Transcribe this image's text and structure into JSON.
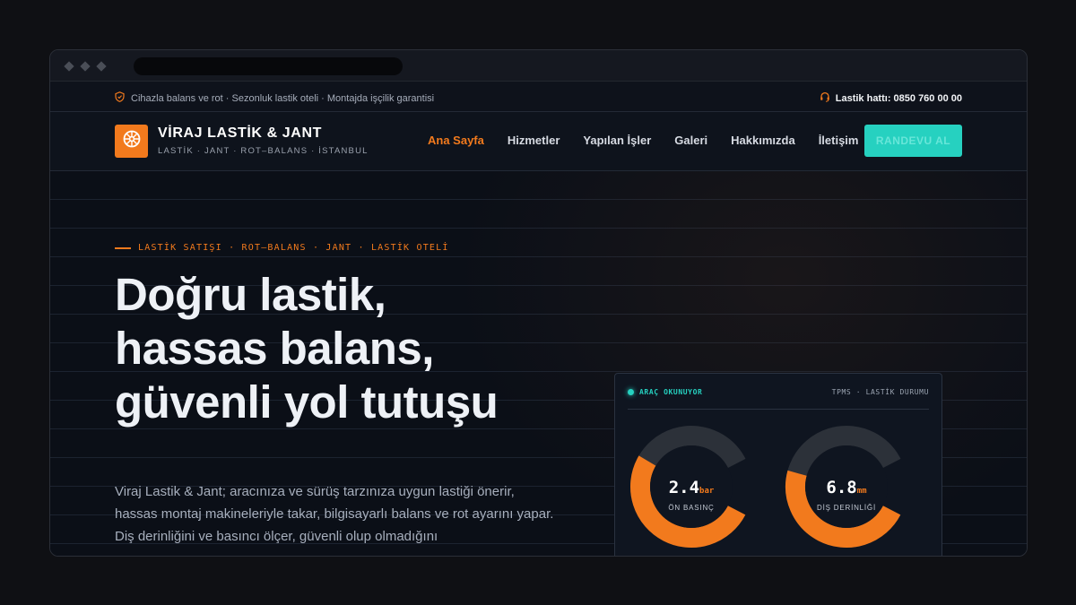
{
  "topbar": {
    "info": "Cihazla balans ve rot · Sezonluk lastik oteli · Montajda işçilik garantisi",
    "hotline": "Lastik hattı: 0850 760 00 00",
    "info_icon": "shield-icon",
    "hotline_icon": "headset-icon"
  },
  "brand": {
    "title": "VİRAJ LASTİK & JANT",
    "subtitle": "LASTİK · JANT · ROT–BALANS · İSTANBUL",
    "logo_icon": "wheel-icon"
  },
  "nav": {
    "items": [
      {
        "label": "Ana Sayfa"
      },
      {
        "label": "Hizmetler"
      },
      {
        "label": "Yapılan İşler"
      },
      {
        "label": "Galeri"
      },
      {
        "label": "Hakkımızda"
      },
      {
        "label": "İletişim"
      }
    ],
    "active_index": 0,
    "cta": "RANDEVU AL"
  },
  "hero": {
    "eyebrow": "LASTİK SATIŞI · ROT–BALANS · JANT · LASTİK OTELİ",
    "headline": "Doğru lastik, hassas balans, güvenli yol tutuşu",
    "lead": "Viraj Lastik & Jant; aracınıza ve sürüş tarzınıza uygun lastiği önerir, hassas montaj makineleriyle takar, bilgisayarlı balans ve rot ayarını yapar. Diş derinliğini ve basıncı ölçer, güvenli olup olmadığını"
  },
  "card": {
    "status": "ARAÇ OKUNUYOR",
    "title": "TPMS · LASTİK DURUMU",
    "gauges": [
      {
        "value": "2.4",
        "unit": "bar",
        "label": "ÖN BASINÇ",
        "fill_fraction": 0.6
      },
      {
        "value": "6.8",
        "unit": "mm",
        "label": "DİŞ DERİNLİĞİ",
        "fill_fraction": 0.55
      }
    ]
  },
  "colors": {
    "accent": "#f27a1d",
    "teal": "#26d1c0",
    "background": "#0b0f17"
  }
}
